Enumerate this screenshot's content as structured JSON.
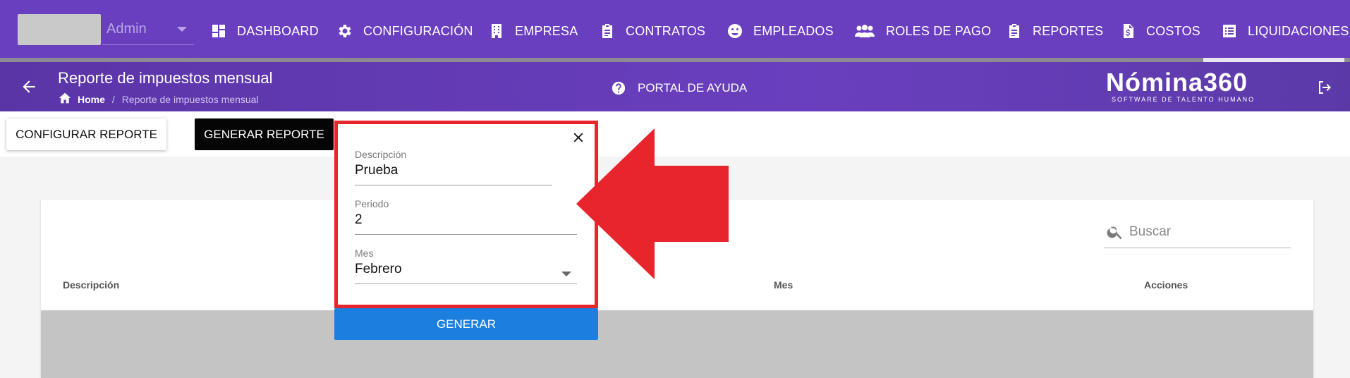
{
  "nav": {
    "company_value": "Admin",
    "items": [
      {
        "label": "DASHBOARD",
        "icon": "dashboard-icon"
      },
      {
        "label": "CONFIGURACIÓN",
        "icon": "gear-icon"
      },
      {
        "label": "EMPRESA",
        "icon": "building-icon"
      },
      {
        "label": "CONTRATOS",
        "icon": "clipboard-icon"
      },
      {
        "label": "EMPLEADOS",
        "icon": "face-icon"
      },
      {
        "label": "ROLES DE PAGO",
        "icon": "people-icon"
      },
      {
        "label": "REPORTES",
        "icon": "clipboard-icon"
      },
      {
        "label": "COSTOS",
        "icon": "invoice-icon"
      },
      {
        "label": "LIQUIDACIONES",
        "icon": "list-icon"
      }
    ]
  },
  "header": {
    "title": "Reporte de impuestos mensual",
    "breadcrumb_home": "Home",
    "breadcrumb_sep": "/",
    "breadcrumb_current": "Reporte de impuestos mensual",
    "help_label": "PORTAL DE AYUDA",
    "logo_main": "Nómina360",
    "logo_sub": "SOFTWARE DE TALENTO HUMANO"
  },
  "toolbar": {
    "configure_label": "CONFIGURAR REPORTE",
    "generate_label": "GENERAR REPORTE"
  },
  "table": {
    "search_placeholder": "Buscar",
    "columns": [
      "Descripción",
      "Mes",
      "Acciones"
    ]
  },
  "popup": {
    "fields": [
      {
        "label": "Descripción",
        "value": "Prueba"
      },
      {
        "label": "Periodo",
        "value": "2"
      },
      {
        "label": "Mes",
        "value": "Febrero"
      }
    ],
    "submit_label": "GENERAR"
  },
  "colors": {
    "nav_bg": "#6a3fbf",
    "highlight_red": "#e8242d",
    "primary_blue": "#1c7fe0"
  }
}
